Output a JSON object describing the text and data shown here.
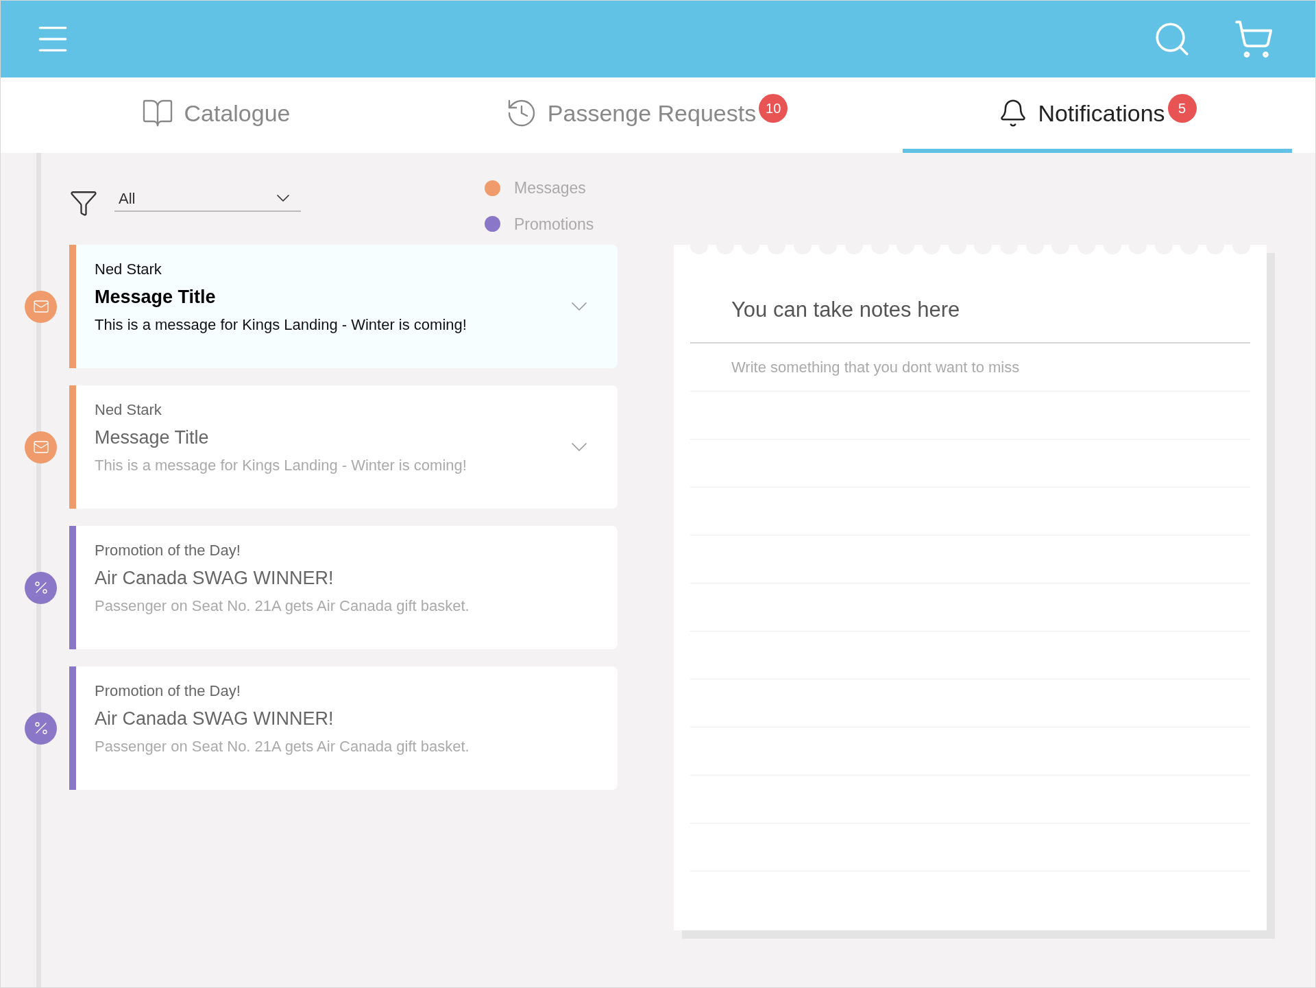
{
  "tabs": [
    {
      "label": "Catalogue",
      "kind": "catalogue",
      "selected": false
    },
    {
      "label": "Passenge Requests",
      "kind": "requests",
      "badge": "10",
      "selected": false
    },
    {
      "label": "Notifications",
      "kind": "notifications",
      "badge": "5",
      "selected": true
    }
  ],
  "filter": {
    "value": "All"
  },
  "legend": [
    {
      "label": "Messages",
      "color": "#f09b6c"
    },
    {
      "label": "Promotions",
      "color": "#8a77c8"
    }
  ],
  "notifications": [
    {
      "kind": "message",
      "color": "#f09b6c",
      "selected": true,
      "sender": "Ned Stark",
      "title": "Message Title",
      "body": "This is a message for Kings Landing - Winter is coming!"
    },
    {
      "kind": "message",
      "color": "#f09b6c",
      "selected": false,
      "sender": "Ned Stark",
      "title": "Message Title",
      "body": "This is a message for Kings Landing - Winter is coming!"
    },
    {
      "kind": "promotion",
      "color": "#8a77c8",
      "selected": false,
      "sender": "Promotion of the Day!",
      "title": "Air Canada SWAG WINNER!",
      "body": "Passenger on Seat No. 21A gets Air Canada gift basket."
    },
    {
      "kind": "promotion",
      "color": "#8a77c8",
      "selected": false,
      "sender": "Promotion of the Day!",
      "title": "Air Canada SWAG WINNER!",
      "body": "Passenger on Seat No. 21A gets Air Canada gift basket."
    }
  ],
  "notes": {
    "title": "You can take notes here",
    "placeholder": "Write something that you dont want to miss"
  }
}
